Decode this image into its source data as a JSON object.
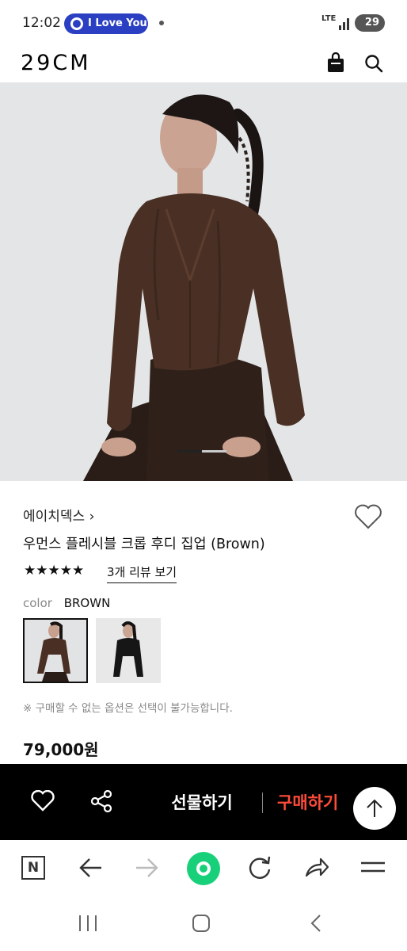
{
  "status_bar": {
    "time": "12:02",
    "notification_pill": "I Love You",
    "network": "LTE",
    "battery": "29"
  },
  "header": {
    "logo": "29CM",
    "icons": [
      "shopping-bag-icon",
      "search-icon"
    ]
  },
  "product": {
    "image_pager": {
      "current": 1,
      "total": 2
    },
    "brand": "에이치덱스 ›",
    "title": "우먼스 플레시블 크롭 후디 집업 (Brown)",
    "rating": {
      "stars": 5,
      "display": "★★★★★"
    },
    "review_link": "3개 리뷰 보기",
    "color_label": "color",
    "color_value": "BROWN",
    "color_options": [
      "Brown",
      "Black"
    ],
    "selected_color_index": 0,
    "notice": "※ 구매할 수 없는 옵션은 선택이 불가능합니다.",
    "price": "79,000원"
  },
  "action_bar": {
    "gift_label": "선물하기",
    "buy_label": "구매하기",
    "icons": [
      "heart-outline-icon",
      "share-icon",
      "arrow-up-icon"
    ]
  },
  "browser_bar": {
    "n_label": "N",
    "icons": [
      "back-arrow-icon",
      "forward-arrow-icon",
      "home-icon",
      "refresh-icon",
      "share-forward-icon",
      "menu-icon"
    ]
  },
  "colors": {
    "accent_buy": "#ff4b3a",
    "pill_blue": "#2b3fc2",
    "home_green": "#19d07a",
    "action_bar_bg": "#000000"
  }
}
